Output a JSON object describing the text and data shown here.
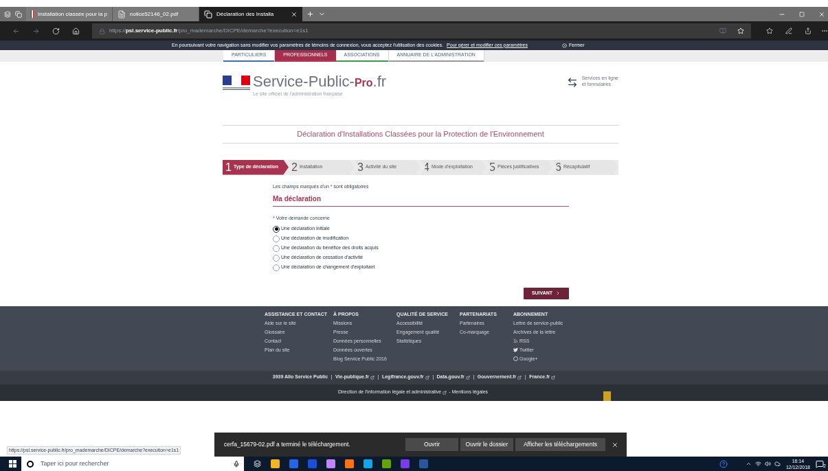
{
  "browser": {
    "tabs": [
      {
        "label": "Installation classée pour la p",
        "selected": false,
        "kind": "flag"
      },
      {
        "label": "notice52146_02.pdf",
        "selected": false,
        "kind": "pdf"
      },
      {
        "label": "Déclaration des Installa",
        "selected": true,
        "kind": "page"
      }
    ],
    "url": "https://**psl.service-public.fr**/pro_mademarche/DICPE/demarche?execution=e1s1"
  },
  "cookie_banner": {
    "text": "En poursuivant votre navigation sans modifier vos paramètres de témoins de connexion, vous acceptez l'utilisation des cookies.",
    "link": "Pour gérer et modifier ces paramètres",
    "close": "Fermer"
  },
  "site_nav": [
    {
      "label": "PARTICULIERS",
      "selected": false,
      "color": "#3b6fb6"
    },
    {
      "label": "PROFESSIONNELS",
      "selected": true,
      "color": "#b8385a"
    },
    {
      "label": "ASSOCIATIONS",
      "selected": false,
      "color": "#3a9a4a"
    },
    {
      "label": "ANNUAIRE DE L'ADMINISTRATION",
      "selected": false,
      "color": "#9a9a9a"
    }
  ],
  "header": {
    "brand": "Service-Public-**Pro**.fr",
    "tagline": "Le site officiel de l'administration française",
    "services": [
      "Services en ligne",
      "et formulaires"
    ]
  },
  "page_title": "Déclaration d'Installations Classées pour la Protection de l'Environnement",
  "steps": [
    {
      "number": "1",
      "label": "Type de déclaration",
      "selected": true
    },
    {
      "number": "2",
      "label": "Installation",
      "selected": false
    },
    {
      "number": "3",
      "label": "Activité du site",
      "selected": false
    },
    {
      "number": "4",
      "label": "Mode d'exploitation",
      "selected": false
    },
    {
      "number": "5",
      "label": "Pièces justificatives",
      "selected": false
    },
    {
      "number": "6",
      "label": "Récapitulatif",
      "selected": false
    }
  ],
  "form": {
    "required_note": {
      "before": "Les champs marqués d'un",
      "mark": "*",
      "after": "sont obligatoires"
    },
    "section_title": "Ma déclaration",
    "question": {
      "mark": "*",
      "label": "Votre demande concerne"
    },
    "options": [
      {
        "label": "Une déclaration initiale",
        "selected": true
      },
      {
        "label": "Une déclaration de modification",
        "selected": false
      },
      {
        "label": "Une déclaration du bénéfice des droits acquis",
        "selected": false
      },
      {
        "label": "Une déclaration de cessation d'activité",
        "selected": false
      },
      {
        "label": "Une déclaration de changement d'exploitant",
        "selected": false
      }
    ],
    "next": "SUIVANT"
  },
  "footer": {
    "columns": [
      {
        "heading": "ASSISTANCE ET CONTACT",
        "links": [
          {
            "label": "Aide sur le site",
            "kind": "text"
          },
          {
            "label": "Glossaire",
            "kind": "text"
          },
          {
            "label": "Contact",
            "kind": "text"
          },
          {
            "label": "Plan du site",
            "kind": "text"
          }
        ]
      },
      {
        "heading": "À PROPOS",
        "links": [
          {
            "label": "Missions",
            "kind": "text"
          },
          {
            "label": "Presse",
            "kind": "text"
          },
          {
            "label": "Données personnelles",
            "kind": "text"
          },
          {
            "label": "Données ouvertes",
            "kind": "text"
          },
          {
            "label": "Blog Service Public 2016",
            "kind": "text"
          }
        ]
      },
      {
        "heading": "QUALITÉ DE SERVICE",
        "links": [
          {
            "label": "Accessibilité",
            "kind": "text"
          },
          {
            "label": "Engagement qualité",
            "kind": "text"
          },
          {
            "label": "Statistiques",
            "kind": "text"
          }
        ]
      },
      {
        "heading": "PARTENARIATS",
        "links": [
          {
            "label": "Partenaires",
            "kind": "text"
          },
          {
            "label": "Co-marquage",
            "kind": "text"
          }
        ]
      },
      {
        "heading": "ABONNEMENT",
        "links": [
          {
            "label": "Lettre de service-public",
            "kind": "text"
          },
          {
            "label": "Archives de la lettre",
            "kind": "text"
          },
          {
            "label": "RSS",
            "kind": "rss"
          },
          {
            "label": "Twitter",
            "kind": "twitter"
          },
          {
            "label": "Google+",
            "kind": "google"
          }
        ]
      }
    ],
    "partner_links": [
      {
        "label": "3939 Allo Service Public",
        "external": false
      },
      {
        "label": "Vie-publique.fr",
        "external": true
      },
      {
        "label": "Legifrance.gouv.fr",
        "external": true
      },
      {
        "label": "Data.gouv.fr",
        "external": true
      },
      {
        "label": "Gouvernement.fr",
        "external": true
      },
      {
        "label": "France.fr",
        "external": true
      }
    ],
    "legal": [
      {
        "label": "Direction de l'information légale et administrative",
        "external": true
      },
      {
        "label": "- Mentions légales",
        "external": false
      }
    ]
  },
  "status_url": "https://psl.service-public.fr/pro_mademarche/DICPE/demarche?execution=e1s1",
  "download_bar": {
    "message": "cerfa_15679-02.pdf a terminé le téléchargement.",
    "buttons": [
      "Ouvrir",
      "Ouvrir le dossier",
      "Afficher les téléchargements"
    ]
  },
  "taskbar": {
    "search_placeholder": "Taper ici pour rechercher",
    "time": "16:14",
    "date": "12/12/2018",
    "notifications": "2"
  }
}
